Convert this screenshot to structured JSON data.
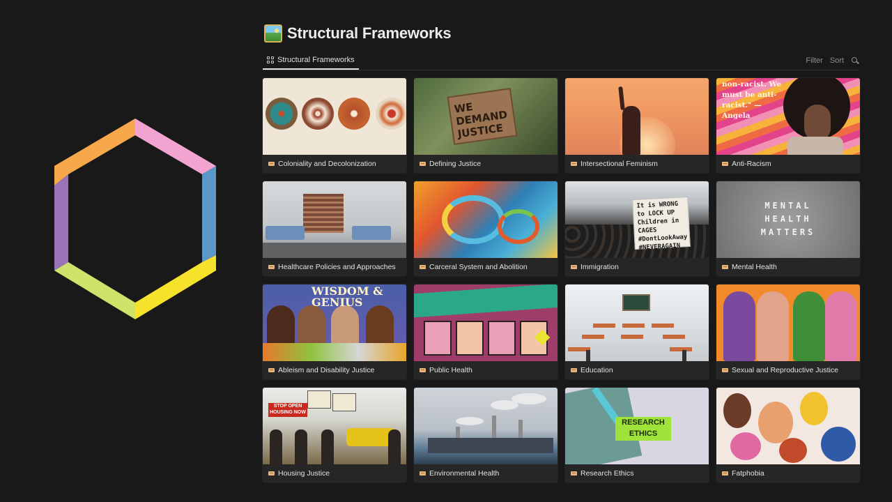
{
  "page": {
    "title": "Structural Frameworks",
    "title_icon": "framed-picture-emoji"
  },
  "toolbar": {
    "view_tab_label": "Structural Frameworks",
    "view_tab_icon": "gallery-grid-icon",
    "filter_label": "Filter",
    "sort_label": "Sort",
    "search_icon": "search-icon"
  },
  "logo": {
    "shape": "hexagon-outline",
    "colors": [
      "#f7a84a",
      "#f2a3cf",
      "#5b97c8",
      "#f7e22b",
      "#cfe36b",
      "#9b74b8"
    ]
  },
  "cards": [
    {
      "label": "Coloniality and Decolonization",
      "icon": "ticket-icon"
    },
    {
      "label": "Defining Justice",
      "icon": "ticket-icon",
      "cover_text": "WE DEMAND JUSTICE"
    },
    {
      "label": "Intersectional Feminism",
      "icon": "ticket-icon"
    },
    {
      "label": "Anti-Racism",
      "icon": "ticket-icon",
      "cover_text": "non-racist. We must be anti-racist.\" — Angela"
    },
    {
      "label": "Healthcare Policies and Approaches",
      "icon": "ticket-icon"
    },
    {
      "label": "Carceral System and Abolition",
      "icon": "ticket-icon"
    },
    {
      "label": "Immigration",
      "icon": "ticket-icon",
      "cover_text": "It is WRONG to LOCK UP Children in CAGES #DontLookAway #NEVERAGAIN"
    },
    {
      "label": "Mental Health",
      "icon": "ticket-icon",
      "cover_text": "MENTAL HEALTH MATTERS"
    },
    {
      "label": "Ableism and Disability Justice",
      "icon": "ticket-icon",
      "cover_text": "WISDOM & GENIUS"
    },
    {
      "label": "Public Health",
      "icon": "ticket-icon"
    },
    {
      "label": "Education",
      "icon": "ticket-icon"
    },
    {
      "label": "Sexual and Reproductive Justice",
      "icon": "ticket-icon"
    },
    {
      "label": "Housing Justice",
      "icon": "ticket-icon",
      "cover_text": "STOP OPEN HOUSING NOW"
    },
    {
      "label": "Environmental Health",
      "icon": "ticket-icon"
    },
    {
      "label": "Research Ethics",
      "icon": "ticket-icon",
      "cover_text": "RESEARCH ETHICS"
    },
    {
      "label": "Fatphobia",
      "icon": "ticket-icon"
    }
  ]
}
